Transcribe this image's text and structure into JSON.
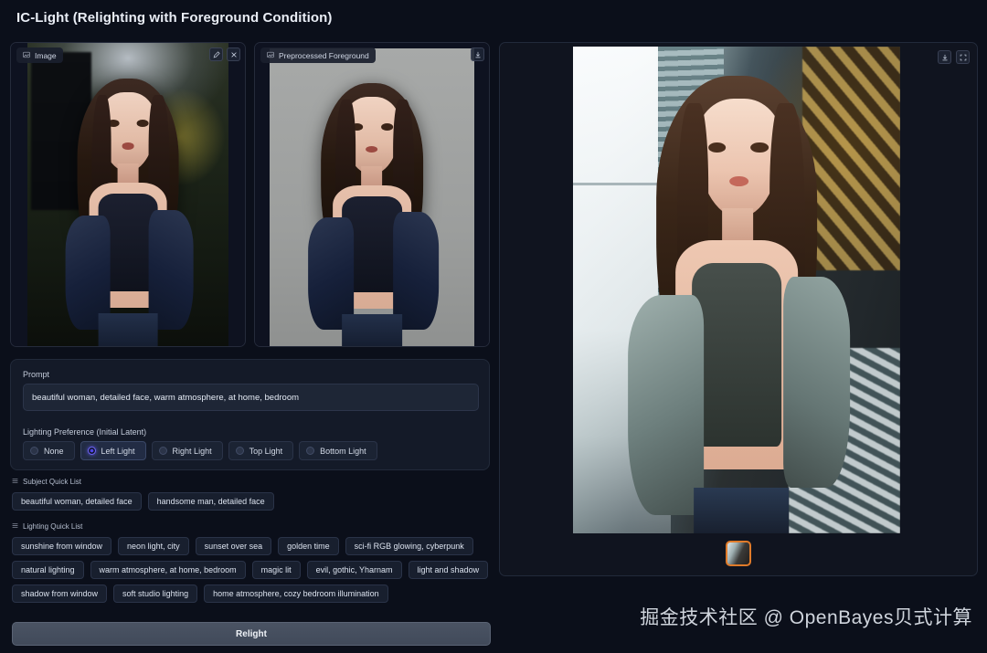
{
  "app": {
    "title": "IC-Light (Relighting with Foreground Condition)",
    "watermark": "掘金技术社区 @ OpenBayes贝式计算"
  },
  "input_panel": {
    "label": "Image",
    "label_icon": "image-icon",
    "tools": [
      {
        "name": "edit-icon",
        "glyph": "pencil"
      },
      {
        "name": "clear-icon",
        "glyph": "close"
      }
    ]
  },
  "foreground_panel": {
    "label": "Preprocessed Foreground",
    "label_icon": "image-icon",
    "tools": [
      {
        "name": "download-icon",
        "glyph": "download"
      }
    ]
  },
  "settings": {
    "prompt_label": "Prompt",
    "prompt_value": "beautiful woman, detailed face, warm atmosphere, at home, bedroom",
    "prompt_placeholder": "Prompt",
    "lighting_label": "Lighting Preference (Initial Latent)",
    "lighting_options": [
      {
        "label": "None",
        "selected": false
      },
      {
        "label": "Left Light",
        "selected": true
      },
      {
        "label": "Right Light",
        "selected": false
      },
      {
        "label": "Top Light",
        "selected": false
      },
      {
        "label": "Bottom Light",
        "selected": false
      }
    ],
    "selected_lighting": "Left Light"
  },
  "subject_quick_list": {
    "heading": "Subject Quick List",
    "heading_icon": "list-icon",
    "items": [
      "beautiful woman, detailed face",
      "handsome man, detailed face"
    ]
  },
  "lighting_quick_list": {
    "heading": "Lighting Quick List",
    "heading_icon": "list-icon",
    "items": [
      "sunshine from window",
      "neon light, city",
      "sunset over sea",
      "golden time",
      "sci-fi RGB glowing, cyberpunk",
      "natural lighting",
      "warm atmosphere, at home, bedroom",
      "magic lit",
      "evil, gothic, Yharnam",
      "light and shadow",
      "shadow from window",
      "soft studio lighting",
      "home atmosphere, cozy bedroom illumination"
    ]
  },
  "actions": {
    "relight_label": "Relight"
  },
  "output_panel": {
    "tools": [
      {
        "name": "download-icon",
        "glyph": "download"
      },
      {
        "name": "fullscreen-icon",
        "glyph": "expand"
      }
    ],
    "gallery": [
      {
        "name": "result-thumbnail-1",
        "selected": true
      }
    ]
  },
  "colors": {
    "page_background": "#0b0f1a",
    "panel_background": "#141a28",
    "panel_border": "#222a3a",
    "accent_radio": "#4f46e5",
    "thumbnail_selected_border": "#e07b2a",
    "text_primary": "#e9edf5",
    "text_secondary": "#b6bfd0",
    "button_background": "#4a5363"
  }
}
